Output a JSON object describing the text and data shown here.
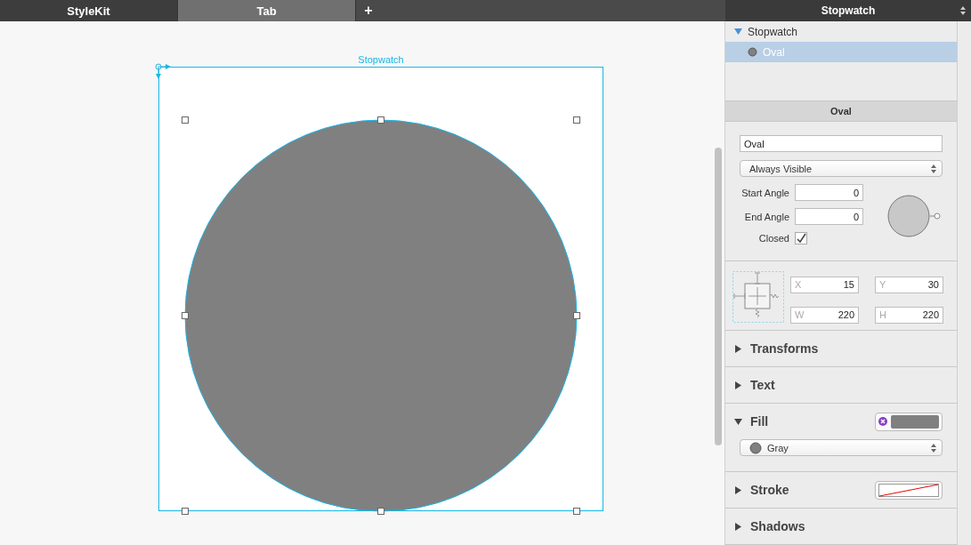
{
  "tabs": [
    {
      "label": "StyleKit",
      "selected": false
    },
    {
      "label": "Tab",
      "selected": true
    }
  ],
  "add_tab": "+",
  "canvas": {
    "artboard_title": "Stopwatch"
  },
  "inspector": {
    "title": "Stopwatch",
    "tree": [
      {
        "label": "Stopwatch",
        "expanded": true,
        "selected": false,
        "children": [
          {
            "label": "Oval",
            "selected": true
          }
        ]
      }
    ],
    "section_title": "Oval",
    "name_field": "Oval",
    "visibility": "Always Visible",
    "angles": [
      {
        "label": "Start Angle",
        "value": "0"
      },
      {
        "label": "End Angle",
        "value": "0"
      }
    ],
    "closed": {
      "label": "Closed",
      "checked": true
    },
    "geometry": [
      {
        "label": "X",
        "value": "15"
      },
      {
        "label": "Y",
        "value": "30"
      },
      {
        "label": "W",
        "value": "220"
      },
      {
        "label": "H",
        "value": "220"
      }
    ],
    "sections": [
      {
        "label": "Transforms",
        "expanded": false,
        "kind": "plain"
      },
      {
        "label": "Text",
        "expanded": false,
        "kind": "plain"
      },
      {
        "label": "Fill",
        "expanded": true,
        "kind": "fill",
        "swatch": "Gray"
      },
      {
        "label": "Stroke",
        "expanded": false,
        "kind": "stroke"
      },
      {
        "label": "Shadows",
        "expanded": false,
        "kind": "plain"
      }
    ]
  }
}
